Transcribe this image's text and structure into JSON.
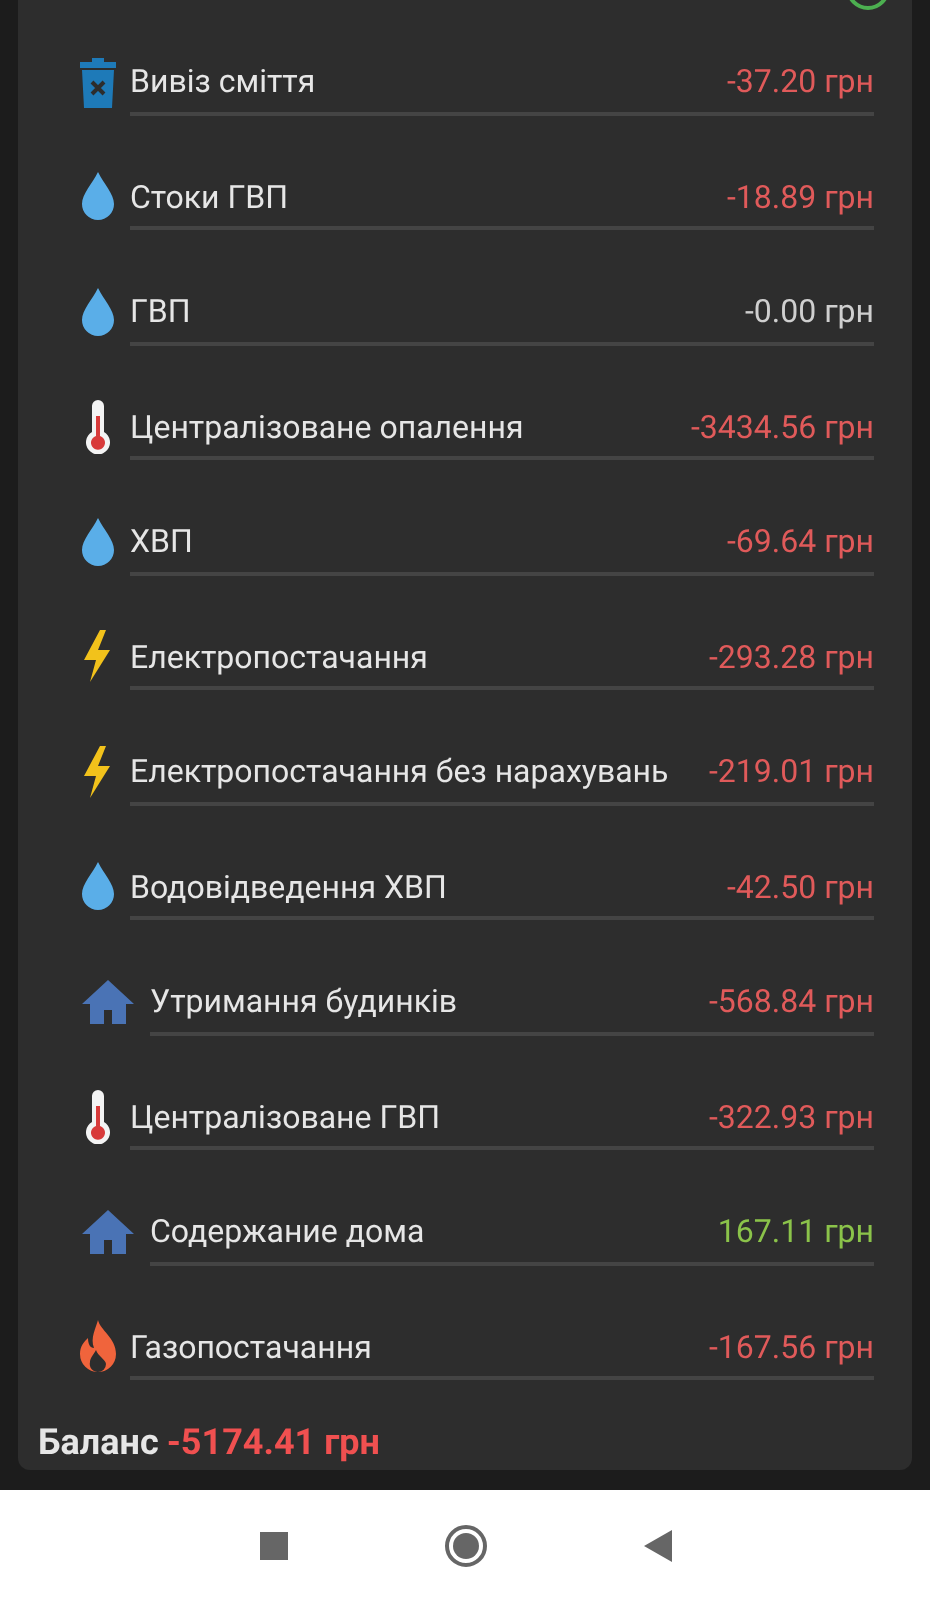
{
  "items": [
    {
      "kind": "trash",
      "name": "Вивіз сміття",
      "amount": "-37.20 грн",
      "color": "#e05a5a"
    },
    {
      "kind": "drop",
      "name": "Стоки ГВП",
      "amount": "-18.89 грн",
      "color": "#e05a5a"
    },
    {
      "kind": "drop",
      "name": "ГВП",
      "amount": "-0.00 грн",
      "color": "#cfcfcf"
    },
    {
      "kind": "thermometer",
      "name": "Централізоване опалення",
      "amount": "-3434.56 грн",
      "color": "#e05a5a"
    },
    {
      "kind": "drop",
      "name": "ХВП",
      "amount": "-69.64 грн",
      "color": "#e05a5a"
    },
    {
      "kind": "bolt",
      "name": "Електропостачання",
      "amount": "-293.28 грн",
      "color": "#e05a5a"
    },
    {
      "kind": "bolt",
      "name": "Електропостачання без нарахувань",
      "amount": "-219.01 грн",
      "color": "#e05a5a"
    },
    {
      "kind": "drop",
      "name": "Водовідведення ХВП",
      "amount": "-42.50 грн",
      "color": "#e05a5a"
    },
    {
      "kind": "house",
      "name": "Утримання будинків",
      "amount": "-568.84 грн",
      "color": "#e05a5a"
    },
    {
      "kind": "thermometer",
      "name": "Централізоване ГВП",
      "amount": "-322.93 грн",
      "color": "#e05a5a"
    },
    {
      "kind": "house",
      "name": "Содержание дома",
      "amount": "167.11 грн",
      "color": "#8bc34a"
    },
    {
      "kind": "flame",
      "name": "Газопостачання",
      "amount": "-167.56 грн",
      "color": "#e05a5a"
    }
  ],
  "balance": {
    "label": "Баланс",
    "amount": "-5174.41 грн"
  }
}
